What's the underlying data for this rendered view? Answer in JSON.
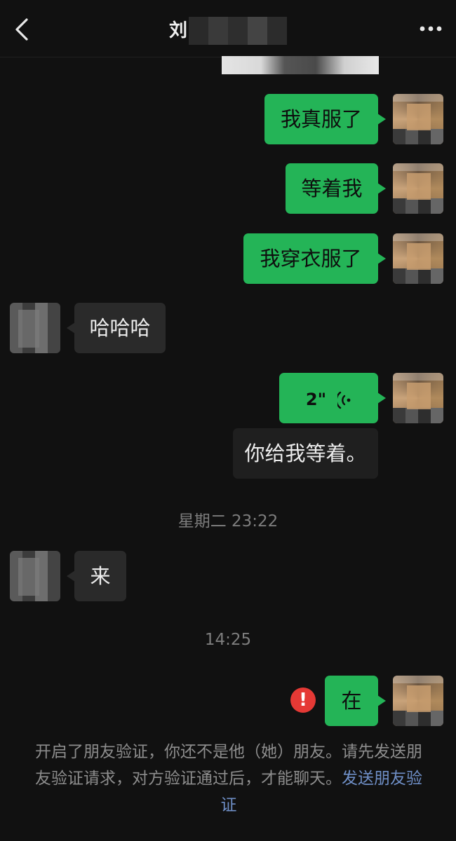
{
  "header": {
    "title": "刘",
    "back_icon": "chevron-left-icon",
    "more_icon": "more-horizontal-icon"
  },
  "messages": [
    {
      "type": "text",
      "direction": "out",
      "text": "我真服了"
    },
    {
      "type": "text",
      "direction": "out",
      "text": "等着我"
    },
    {
      "type": "text",
      "direction": "out",
      "text": "我穿衣服了"
    },
    {
      "type": "text",
      "direction": "in",
      "text": "哈哈哈"
    },
    {
      "type": "voice",
      "direction": "out",
      "duration": "2\"",
      "icon": "voice-wave-icon"
    },
    {
      "type": "transcription",
      "direction": "out",
      "text": "你给我等着。"
    },
    {
      "type": "timestamp",
      "text": "星期二 23:22"
    },
    {
      "type": "text",
      "direction": "in",
      "text": "来"
    },
    {
      "type": "timestamp",
      "text": "14:25"
    },
    {
      "type": "text",
      "direction": "out",
      "text": "在",
      "failed": true
    }
  ],
  "error_icon": {
    "symbol": "!",
    "color": "#e53935"
  },
  "system_notice": {
    "text": "开启了朋友验证，你还不是他（她）朋友。请先发送朋友验证请求，对方验证通过后，才能聊天。",
    "link": "发送朋友验证"
  },
  "colors": {
    "background": "#111111",
    "outgoing_bubble": "#24b457",
    "incoming_bubble": "#2a2a2a",
    "link": "#6f8fc7"
  }
}
